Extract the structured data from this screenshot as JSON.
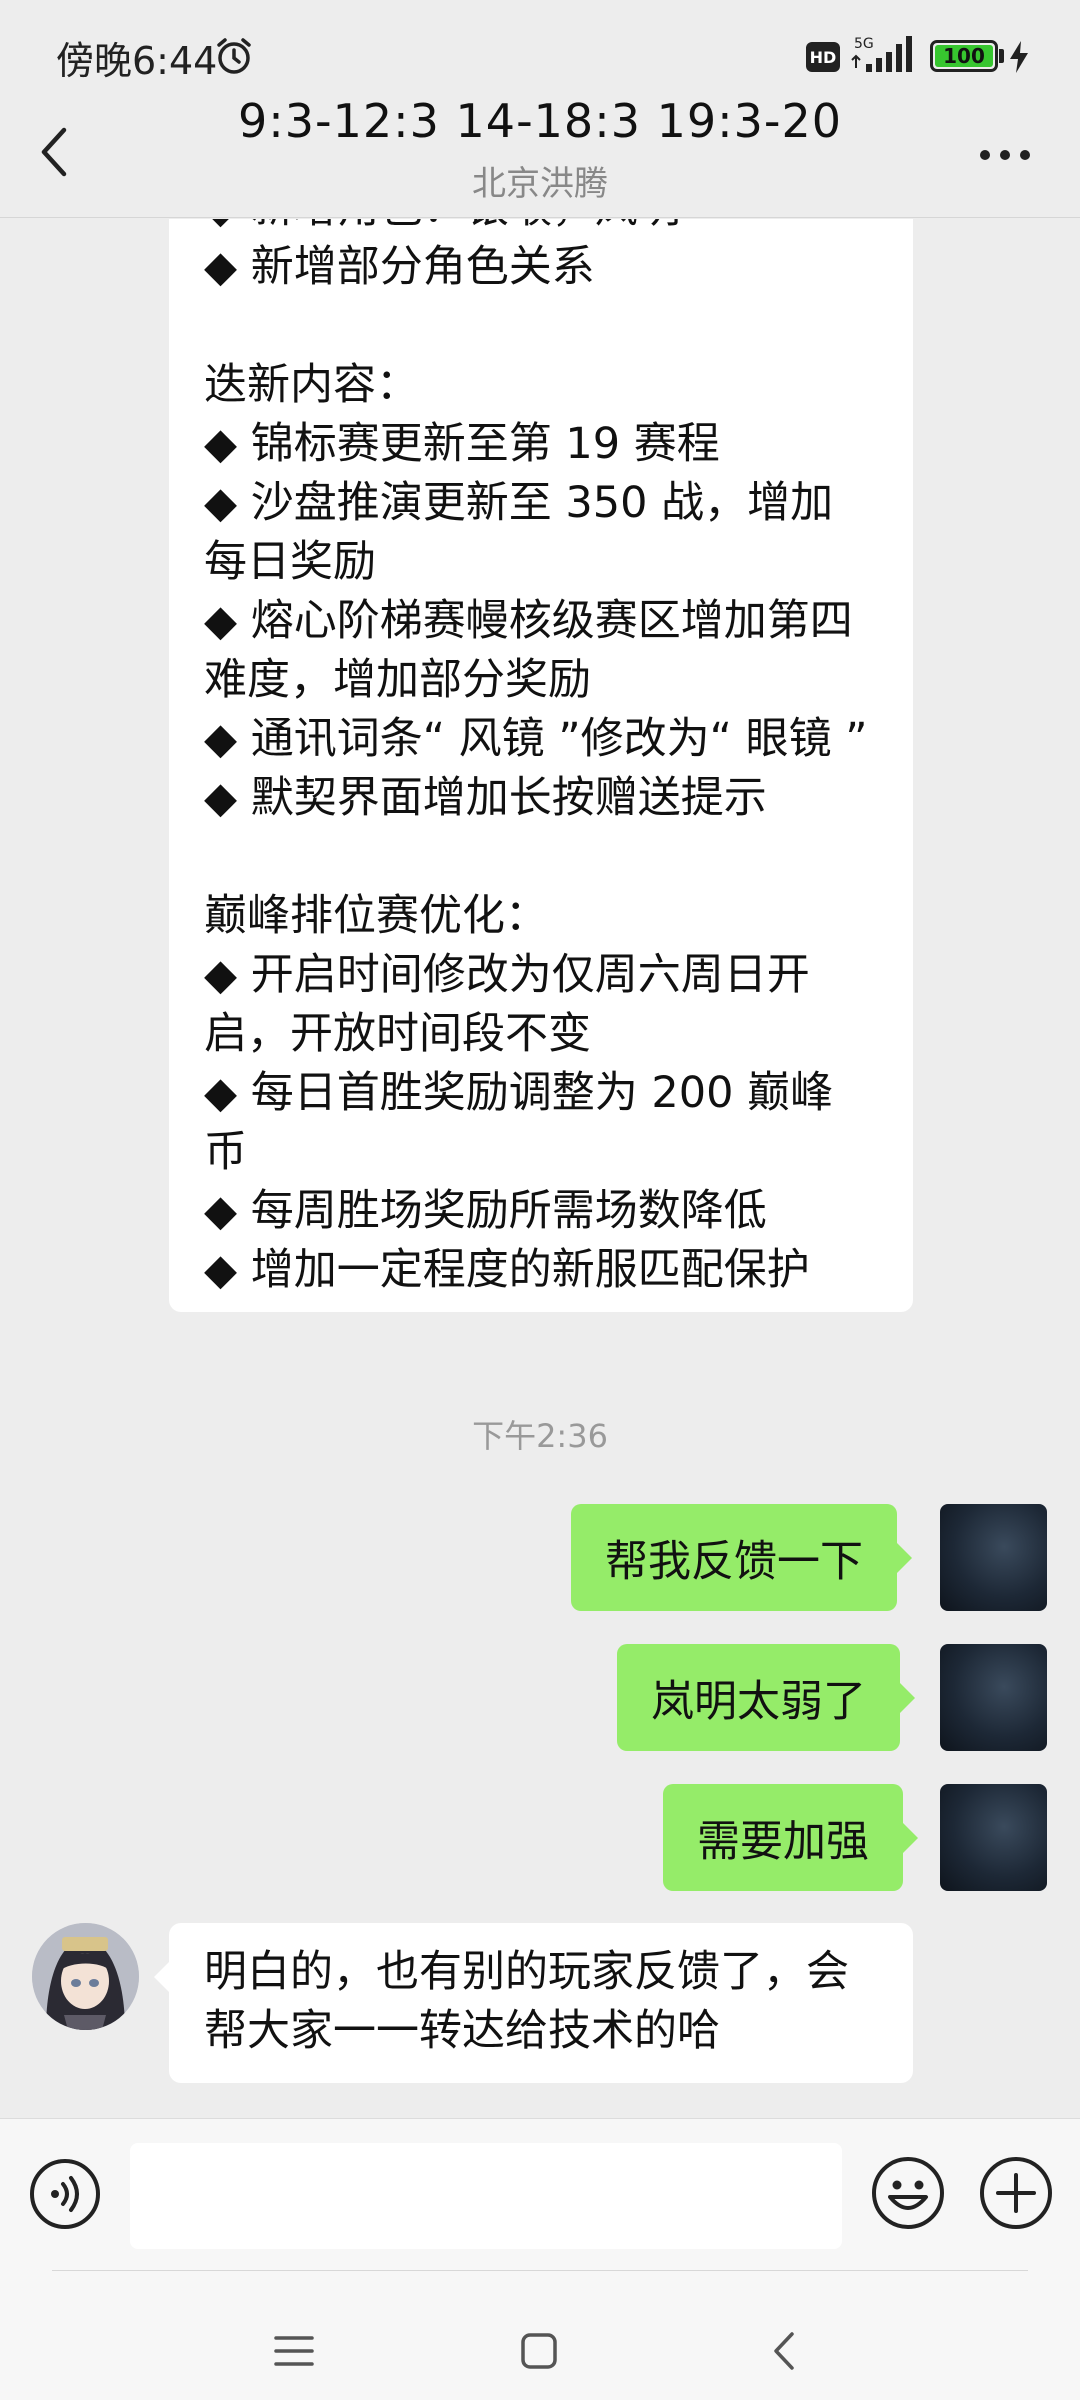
{
  "status_bar": {
    "time": "傍晚6:44",
    "network": "5G",
    "hd_badge": "HD",
    "battery": "100",
    "icons": [
      "alarm-icon",
      "hd-icon",
      "signal-icon",
      "battery-icon",
      "charge-icon"
    ]
  },
  "header": {
    "title": "9:3-12:3 14-18:3 19:3-20",
    "subtitle": "北京洪腾",
    "icons": [
      "back-icon",
      "more-icon"
    ]
  },
  "messages": {
    "long_message_lines": [
      "◆ 新增角色：银喉，岚明",
      "◆ 新增部分角色关系",
      "",
      "迭新内容：",
      "◆ 锦标赛更新至第 19 赛程",
      "◆ 沙盘推演更新至 350 战，增加",
      "每日奖励",
      "◆ 熔心阶梯赛幔核级赛区增加第四",
      "难度，增加部分奖励",
      "◆ 通讯词条“ 风镜 ”修改为“ 眼镜 ”",
      "◆ 默契界面增加长按赠送提示",
      "",
      "巅峰排位赛优化：",
      "◆ 开启时间修改为仅周六周日开",
      "启，开放时间段不变",
      "◆ 每日首胜奖励调整为 200 巅峰",
      "币",
      "◆ 每周胜场奖励所需场数降低",
      "◆ 增加一定程度的新服匹配保护"
    ],
    "timestamp": "下午2:36",
    "outgoing": [
      "帮我反馈一下",
      "岚明太弱了",
      "需要加强"
    ],
    "reply_lines": [
      "明白的，也有别的玩家反馈了，会",
      "帮大家一一转达给技术的哈"
    ]
  },
  "input_bar": {
    "value": "",
    "icons": [
      "voice-icon",
      "emoji-icon",
      "plus-icon"
    ]
  },
  "nav_bar": {
    "icons": [
      "menu-icon",
      "home-icon",
      "back-icon"
    ]
  },
  "colors": {
    "background": "#ededed",
    "outgoing_bubble": "#95ec69",
    "incoming_bubble": "#ffffff",
    "battery_fill": "#37c62f"
  }
}
